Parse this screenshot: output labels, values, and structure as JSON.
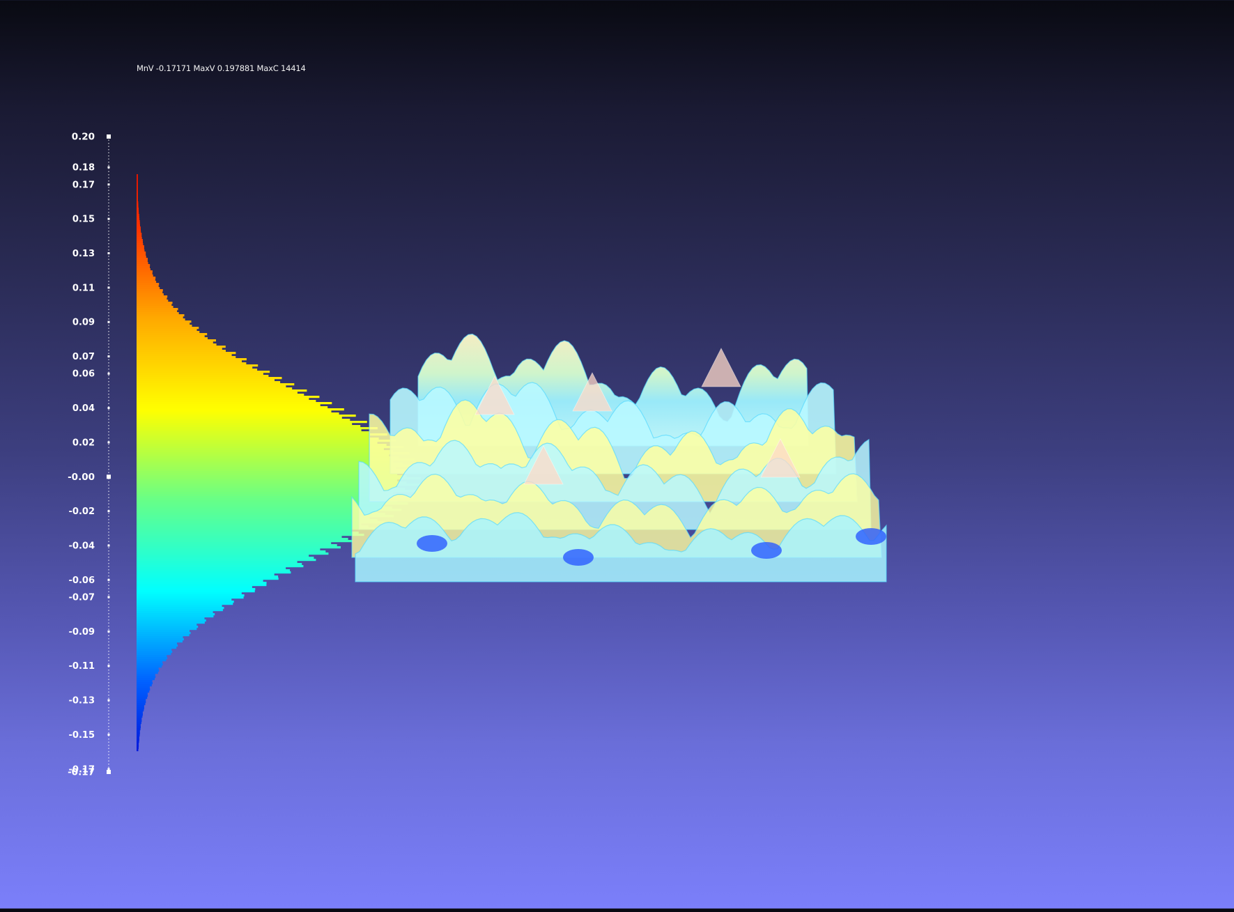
{
  "stats_text": "MnV -0.17171 MaxV 0.197881 MaxC 14414",
  "scale": {
    "min": -0.17171,
    "max": 0.197881,
    "max_count": 14414,
    "tick_labels": [
      "0.20",
      "0.18",
      "0.17",
      "0.15",
      "0.13",
      "0.11",
      "0.09",
      "0.07",
      "0.06",
      "0.04",
      "0.02",
      "-0.00",
      "-0.02",
      "-0.04",
      "-0.06",
      "-0.07",
      "-0.09",
      "-0.11",
      "-0.13",
      "-0.15",
      "-0.17",
      "-0.17"
    ],
    "tick_values": [
      0.197881,
      0.18,
      0.17,
      0.15,
      0.13,
      0.11,
      0.09,
      0.07,
      0.06,
      0.04,
      0.02,
      0.0,
      -0.02,
      -0.04,
      -0.06,
      -0.07,
      -0.09,
      -0.11,
      -0.13,
      -0.15,
      -0.17,
      -0.17171
    ]
  },
  "histogram": {
    "colormap": [
      "#0000d0",
      "#0060ff",
      "#00ffff",
      "#66ff88",
      "#ffff00",
      "#ffaa00",
      "#ff3300",
      "#cc0000"
    ]
  },
  "surface": {
    "colors": [
      "#b8f8ff",
      "#ffffa0",
      "#ffd9c8",
      "#55d8ff",
      "#2a5bff"
    ]
  }
}
